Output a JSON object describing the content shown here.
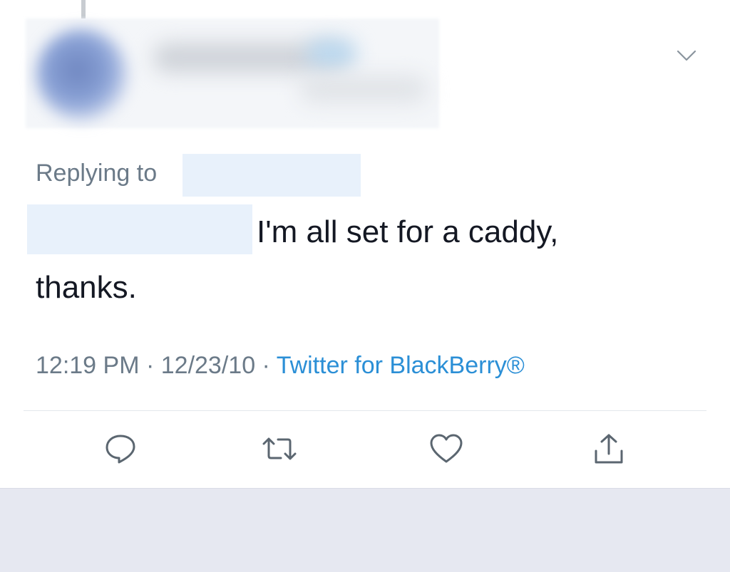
{
  "tweet": {
    "replying_to_label": "Replying to",
    "text_line1": "I'm all set for a caddy,",
    "text_line2": "thanks."
  },
  "meta": {
    "time": "12:19 PM",
    "separator1": " · ",
    "date": "12/23/10",
    "separator2": " · ",
    "source": "Twitter for BlackBerry®"
  },
  "actions": [
    {
      "name": "reply",
      "icon": "reply-icon"
    },
    {
      "name": "retweet",
      "icon": "retweet-icon"
    },
    {
      "name": "like",
      "icon": "heart-icon"
    },
    {
      "name": "share",
      "icon": "share-icon"
    }
  ],
  "colors": {
    "text_primary": "#141823",
    "text_secondary": "#6b7a88",
    "link_blue": "#2b8fd6",
    "icon_gray": "#5b6670",
    "footer_bg": "#e6e8f1"
  }
}
